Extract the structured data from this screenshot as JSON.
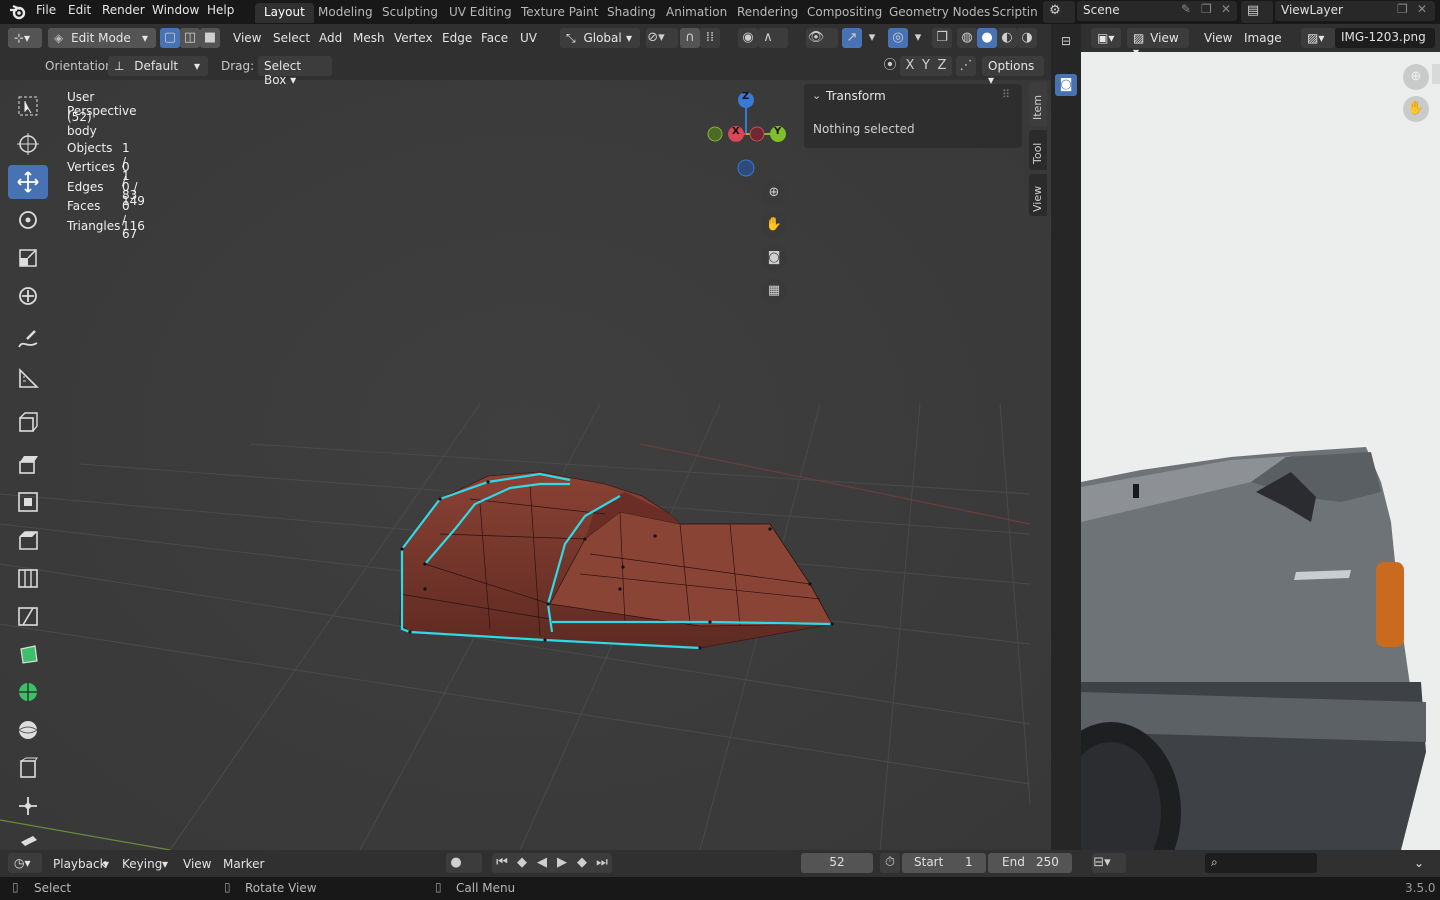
{
  "topmenu": {
    "items": [
      "File",
      "Edit",
      "Render",
      "Window",
      "Help"
    ],
    "workspaces": [
      "Layout",
      "Modeling",
      "Sculpting",
      "UV Editing",
      "Texture Paint",
      "Shading",
      "Animation",
      "Rendering",
      "Compositing",
      "Geometry Nodes",
      "Scripting"
    ],
    "active_workspace": "Layout",
    "scene": "Scene",
    "view_layer": "ViewLayer"
  },
  "viewport_header": {
    "mode": "Edit Mode",
    "menus": [
      "View",
      "Select",
      "Add",
      "Mesh",
      "Vertex",
      "Edge",
      "Face",
      "UV"
    ],
    "transform_orientation": "Global",
    "orientation_label": "Orientation:",
    "orientation_value": "Default",
    "drag_label": "Drag:",
    "drag_value": "Select Box",
    "axes": [
      "X",
      "Y",
      "Z"
    ],
    "options": "Options"
  },
  "overlay": {
    "view_name": "User Perspective",
    "object_name": "(52) body",
    "stats": [
      {
        "label": "Objects",
        "value": "1 / 1"
      },
      {
        "label": "Vertices",
        "value": "0 / 83"
      },
      {
        "label": "Edges",
        "value": "0 / 149"
      },
      {
        "label": "Faces",
        "value": "0 / 67"
      },
      {
        "label": "Triangles",
        "value": "116"
      }
    ]
  },
  "gizmo": {
    "z": "Z",
    "x": "X",
    "y": "Y"
  },
  "sidebar": {
    "panel_title": "Transform",
    "panel_body": "Nothing selected",
    "tabs": [
      "Item",
      "Tool",
      "View"
    ]
  },
  "image_editor": {
    "menus": [
      "View",
      "View",
      "Image"
    ],
    "image_name": "IMG-1203.png"
  },
  "timeline": {
    "menus": [
      "Playback",
      "Keying",
      "View",
      "Marker"
    ],
    "current_frame": "52",
    "start_label": "Start",
    "start_value": "1",
    "end_label": "End",
    "end_value": "250"
  },
  "statusbar": {
    "select": "Select",
    "rotate": "Rotate View",
    "call_menu": "Call Menu",
    "version": "3.5.0"
  },
  "colors": {
    "accent": "#4772b3",
    "mesh": "#7a3a30",
    "edge_highlight": "#2fd9e6"
  }
}
